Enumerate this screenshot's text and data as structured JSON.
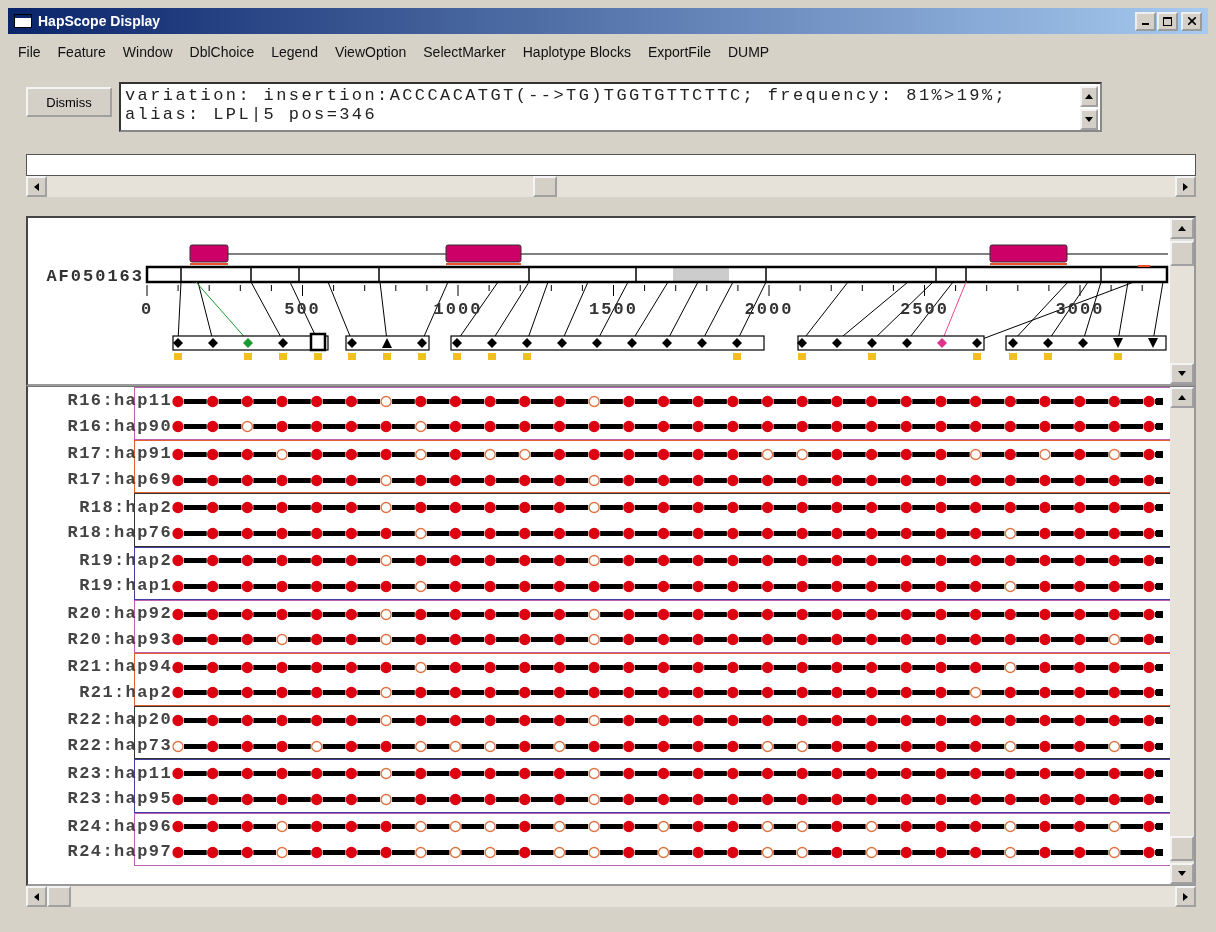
{
  "window": {
    "title": "HapScope Display"
  },
  "menu": [
    "File",
    "Feature",
    "Window",
    "DblChoice",
    "Legend",
    "ViewOption",
    "SelectMarker",
    "Haplotype Blocks",
    "ExportFile",
    "DUMP"
  ],
  "dismiss_button": "Dismiss",
  "message_lines": [
    "variation: insertion:ACCCACATGT(-->TG)TGGTGTTCTTC; frequency: 81%>19%;",
    "alias: LPL|5 pos=346"
  ],
  "gene_map": {
    "sequence": "AF050163",
    "axis_labels": [
      "0",
      "500",
      "1000",
      "1500",
      "2000",
      "2500",
      "3000"
    ]
  },
  "haplotype_groups": [
    {
      "color": "#c060b0",
      "rows": [
        {
          "label": "R16:hap11",
          "minor": [
            false,
            false,
            false,
            false,
            false,
            false,
            true,
            false,
            false,
            false,
            false,
            false,
            true,
            false,
            false,
            false,
            false,
            false,
            false,
            false,
            false,
            false,
            false,
            false,
            false,
            false,
            false,
            false,
            false
          ]
        },
        {
          "label": "R16:hap90",
          "minor": [
            false,
            false,
            true,
            false,
            false,
            false,
            false,
            true,
            false,
            false,
            false,
            false,
            false,
            false,
            false,
            false,
            false,
            false,
            false,
            false,
            false,
            false,
            false,
            false,
            false,
            false,
            false,
            false,
            false
          ]
        }
      ]
    },
    {
      "color": "#e06030",
      "rows": [
        {
          "label": "R17:hap91",
          "minor": [
            false,
            false,
            false,
            true,
            false,
            false,
            false,
            true,
            false,
            true,
            true,
            false,
            false,
            false,
            false,
            false,
            false,
            true,
            true,
            false,
            false,
            false,
            false,
            true,
            false,
            true,
            false,
            true,
            false
          ]
        },
        {
          "label": "R17:hap69",
          "minor": [
            false,
            false,
            false,
            false,
            false,
            false,
            true,
            false,
            false,
            false,
            false,
            false,
            true,
            false,
            false,
            false,
            false,
            false,
            false,
            false,
            false,
            false,
            false,
            false,
            false,
            false,
            false,
            false,
            false
          ]
        }
      ]
    },
    {
      "color": "#333333",
      "rows": [
        {
          "label": "R18:hap2",
          "minor": [
            false,
            false,
            false,
            false,
            false,
            false,
            true,
            false,
            false,
            false,
            false,
            false,
            true,
            false,
            false,
            false,
            false,
            false,
            false,
            false,
            false,
            false,
            false,
            false,
            false,
            false,
            false,
            false,
            false
          ]
        },
        {
          "label": "R18:hap76",
          "minor": [
            false,
            false,
            false,
            false,
            false,
            false,
            false,
            true,
            false,
            false,
            false,
            false,
            false,
            false,
            false,
            false,
            false,
            false,
            false,
            false,
            false,
            false,
            false,
            false,
            true,
            false,
            false,
            false,
            false
          ]
        }
      ]
    },
    {
      "color": "#4040a0",
      "rows": [
        {
          "label": "R19:hap2",
          "minor": [
            false,
            false,
            false,
            false,
            false,
            false,
            true,
            false,
            false,
            false,
            false,
            false,
            true,
            false,
            false,
            false,
            false,
            false,
            false,
            false,
            false,
            false,
            false,
            false,
            false,
            false,
            false,
            false,
            false
          ]
        },
        {
          "label": "R19:hap1",
          "minor": [
            false,
            false,
            false,
            false,
            false,
            false,
            false,
            true,
            false,
            false,
            false,
            false,
            false,
            false,
            false,
            false,
            false,
            false,
            false,
            false,
            false,
            false,
            false,
            false,
            true,
            false,
            false,
            false,
            false
          ]
        }
      ]
    },
    {
      "color": "#c060b0",
      "rows": [
        {
          "label": "R20:hap92",
          "minor": [
            false,
            false,
            false,
            false,
            false,
            false,
            true,
            false,
            false,
            false,
            false,
            false,
            true,
            false,
            false,
            false,
            false,
            false,
            false,
            false,
            false,
            false,
            false,
            false,
            false,
            false,
            false,
            false,
            false
          ]
        },
        {
          "label": "R20:hap93",
          "minor": [
            false,
            false,
            false,
            true,
            false,
            false,
            true,
            false,
            false,
            false,
            false,
            false,
            true,
            false,
            false,
            false,
            false,
            false,
            false,
            false,
            false,
            false,
            false,
            false,
            false,
            false,
            false,
            true,
            false
          ]
        }
      ]
    },
    {
      "color": "#e06030",
      "rows": [
        {
          "label": "R21:hap94",
          "minor": [
            false,
            false,
            false,
            false,
            false,
            false,
            false,
            true,
            false,
            false,
            false,
            false,
            false,
            false,
            false,
            false,
            false,
            false,
            false,
            false,
            false,
            false,
            false,
            false,
            true,
            false,
            false,
            false,
            false
          ]
        },
        {
          "label": "R21:hap2",
          "minor": [
            false,
            false,
            false,
            false,
            false,
            false,
            true,
            false,
            false,
            false,
            false,
            false,
            false,
            false,
            false,
            false,
            false,
            false,
            false,
            false,
            false,
            false,
            false,
            true,
            false,
            false,
            false,
            false,
            false
          ]
        }
      ]
    },
    {
      "color": "#333333",
      "rows": [
        {
          "label": "R22:hap20",
          "minor": [
            false,
            false,
            false,
            false,
            false,
            false,
            true,
            false,
            false,
            false,
            false,
            false,
            true,
            false,
            false,
            false,
            false,
            false,
            false,
            false,
            false,
            false,
            false,
            false,
            false,
            false,
            false,
            false,
            false
          ]
        },
        {
          "label": "R22:hap73",
          "minor": [
            true,
            false,
            false,
            false,
            true,
            false,
            false,
            true,
            true,
            true,
            false,
            true,
            false,
            false,
            false,
            false,
            false,
            true,
            true,
            false,
            false,
            false,
            false,
            false,
            true,
            false,
            false,
            true,
            false
          ]
        }
      ]
    },
    {
      "color": "#4040a0",
      "rows": [
        {
          "label": "R23:hap11",
          "minor": [
            false,
            false,
            false,
            false,
            false,
            false,
            true,
            false,
            false,
            false,
            false,
            false,
            true,
            false,
            false,
            false,
            false,
            false,
            false,
            false,
            false,
            false,
            false,
            false,
            false,
            false,
            false,
            false,
            false
          ]
        },
        {
          "label": "R23:hap95",
          "minor": [
            false,
            false,
            false,
            false,
            false,
            false,
            true,
            false,
            false,
            false,
            false,
            false,
            true,
            false,
            false,
            false,
            false,
            false,
            false,
            false,
            false,
            false,
            false,
            false,
            false,
            false,
            false,
            false,
            false
          ]
        }
      ]
    },
    {
      "color": "#c060b0",
      "rows": [
        {
          "label": "R24:hap96",
          "minor": [
            false,
            false,
            false,
            true,
            false,
            false,
            false,
            true,
            true,
            true,
            false,
            true,
            true,
            false,
            true,
            false,
            false,
            true,
            true,
            false,
            true,
            false,
            false,
            false,
            true,
            false,
            false,
            true,
            false
          ]
        },
        {
          "label": "R24:hap97",
          "minor": [
            false,
            false,
            false,
            true,
            false,
            false,
            false,
            true,
            true,
            true,
            false,
            true,
            true,
            false,
            true,
            false,
            false,
            true,
            true,
            false,
            true,
            false,
            false,
            false,
            true,
            false,
            false,
            true,
            false
          ]
        }
      ]
    }
  ]
}
